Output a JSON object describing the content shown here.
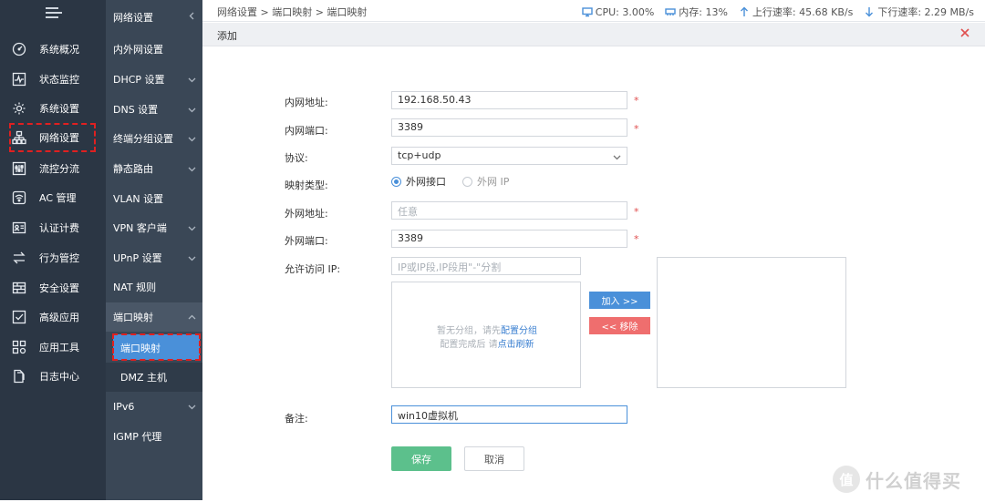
{
  "sidebar_primary": {
    "items": [
      {
        "label": "系统概况",
        "icon": "gauge-icon"
      },
      {
        "label": "状态监控",
        "icon": "pulse-icon"
      },
      {
        "label": "系统设置",
        "icon": "gear-icon"
      },
      {
        "label": "网络设置",
        "icon": "network-icon"
      },
      {
        "label": "流控分流",
        "icon": "sliders-icon"
      },
      {
        "label": "AC 管理",
        "icon": "wifi-icon"
      },
      {
        "label": "认证计费",
        "icon": "id-card-icon"
      },
      {
        "label": "行为管控",
        "icon": "arrows-icon"
      },
      {
        "label": "安全设置",
        "icon": "firewall-icon"
      },
      {
        "label": "高级应用",
        "icon": "checkbox-icon"
      },
      {
        "label": "应用工具",
        "icon": "apps-icon"
      },
      {
        "label": "日志中心",
        "icon": "log-icon"
      }
    ]
  },
  "sidebar_secondary": {
    "title": "网络设置",
    "items": [
      {
        "label": "内外网设置"
      },
      {
        "label": "DHCP 设置"
      },
      {
        "label": "DNS 设置"
      },
      {
        "label": "终端分组设置"
      },
      {
        "label": "静态路由"
      },
      {
        "label": "VLAN 设置"
      },
      {
        "label": "VPN 客户端"
      },
      {
        "label": "UPnP 设置"
      },
      {
        "label": "NAT 规则"
      },
      {
        "label": "端口映射"
      },
      {
        "label": "端口映射"
      },
      {
        "label": "DMZ 主机"
      },
      {
        "label": "IPv6"
      },
      {
        "label": "IGMP 代理"
      }
    ]
  },
  "topbar": {
    "breadcrumb": "网络设置 > 端口映射 > 端口映射",
    "cpu": "CPU: 3.00%",
    "memory": "内存: 13%",
    "upload": "上行速率: 45.68 KB/s",
    "download": "下行速率: 2.29 MB/s"
  },
  "dialog": {
    "title": "添加",
    "fields": {
      "lan_addr_label": "内网地址:",
      "lan_addr_value": "192.168.50.43",
      "lan_port_label": "内网端口:",
      "lan_port_value": "3389",
      "protocol_label": "协议:",
      "protocol_value": "tcp+udp",
      "map_type_label": "映射类型:",
      "map_type_opt1": "外网接口",
      "map_type_opt2": "外网 IP",
      "wan_addr_label": "外网地址:",
      "wan_addr_placeholder": "任意",
      "wan_port_label": "外网端口:",
      "wan_port_value": "3389",
      "allow_ip_label": "允许访问 IP:",
      "allow_ip_placeholder": "IP或IP段,IP段用\"-\"分割",
      "remark_label": "备注:",
      "remark_value": "win10虚拟机"
    },
    "group_box": {
      "line1_prefix": "暂无分组，请先",
      "line1_link": "配置分组",
      "line2_prefix": "配置完成后 请",
      "line2_link": "点击刷新"
    },
    "add_button": "加入 >>",
    "remove_button": "<< 移除",
    "save_button": "保存",
    "cancel_button": "取消",
    "required_mark": "*"
  },
  "watermark": {
    "badge": "值",
    "text": "什么值得买"
  },
  "colors": {
    "accent": "#4a90d9",
    "save": "#5cc08c",
    "remove": "#ef6e6e",
    "sidebar": "#2b3644",
    "sidebar2": "#3a4756",
    "highlight": "#e02020"
  }
}
